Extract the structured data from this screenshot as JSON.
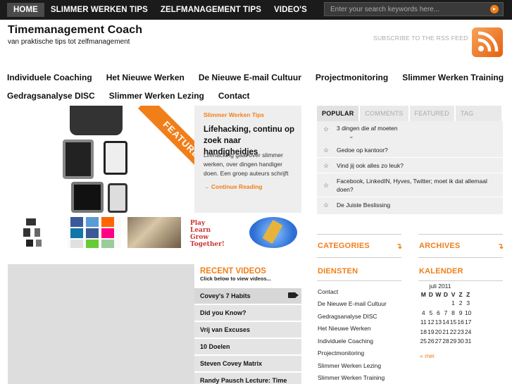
{
  "topnav": [
    {
      "label": "HOME"
    },
    {
      "label": "SLIMMER WERKEN TIPS"
    },
    {
      "label": "ZELFMANAGEMENT TIPS"
    },
    {
      "label": "VIDEO'S"
    }
  ],
  "search": {
    "placeholder": "Enter your search keywords here..."
  },
  "site": {
    "title": "Timemanagement Coach",
    "tagline": "van praktische tips tot zelfmanagement"
  },
  "rss": {
    "label": "SUBSCRIBE TO THE RSS FEED"
  },
  "mainnav": {
    "row1": [
      "Individuele Coaching",
      "Het Nieuwe Werken",
      "De Nieuwe E-mail Cultuur",
      "Projectmonitoring",
      "Slimmer Werken Training"
    ],
    "row2": [
      "Gedragsanalyse DISC",
      "Slimmer Werken Lezing",
      "Contact"
    ]
  },
  "featured": {
    "banner": "FEATURED",
    "category": "Slimmer Werken Tips",
    "title": "Lifehacking, continu op zoek naar handigheidjes",
    "excerpt": "Lifehacking gaat over slimmer werken, over dingen handiger doen. Een groep auteurs schrijft",
    "more": "→ Continue Reading"
  },
  "sidebar_tabs": [
    {
      "label": "POPULAR",
      "active": true
    },
    {
      "label": "COMMENTS",
      "active": false
    },
    {
      "label": "FEATURED",
      "active": false
    },
    {
      "label": "TAG CLOUD",
      "active": false
    }
  ],
  "popular": [
    "3 dingen die af moeten",
    "Gedoe op kantoor?",
    "Vind jij ook alles zo leuk?",
    "Facebook, LinkedIN, Hyves, Twitter; moet ik dat allemaal doen?",
    "De Juiste Beslissing"
  ],
  "widgets": {
    "categories": "CATEGORIES",
    "archives": "ARCHIVES",
    "diensten": "DIENSTEN",
    "kalender": "KALENDER"
  },
  "videos": {
    "heading": "RECENT VIDEOS",
    "sub": "Click below to view videos...",
    "items": [
      "Covey's 7 Habits",
      "Did you Know?",
      "Vrij van Excuses",
      "10 Doelen",
      "Steven Covey Matrix",
      "Randy Pausch Lecture: Time Management"
    ]
  },
  "diensten": [
    "Contact",
    "De Nieuwe E-mail Cultuur",
    "Gedragsanalyse DISC",
    "Het Nieuwe Werken",
    "Individuele Coaching",
    "Projectmonitoring",
    "Slimmer Werken Lezing",
    "Slimmer Werken Training"
  ],
  "calendar": {
    "month": "juli 2011",
    "days": [
      "M",
      "D",
      "W",
      "D",
      "V",
      "Z",
      "Z"
    ],
    "weeks": [
      [
        "",
        "",
        "",
        "",
        "1",
        "2",
        "3"
      ],
      [
        "4",
        "5",
        "6",
        "7",
        "8",
        "9",
        "10"
      ],
      [
        "11",
        "12",
        "13",
        "14",
        "15",
        "16",
        "17"
      ],
      [
        "18",
        "19",
        "20",
        "21",
        "22",
        "23",
        "24"
      ],
      [
        "25",
        "26",
        "27",
        "28",
        "29",
        "30",
        "31"
      ]
    ],
    "prev": "« mei"
  },
  "colors": {
    "accent": "#f07f1a",
    "topbar": "#1b1b1b"
  }
}
